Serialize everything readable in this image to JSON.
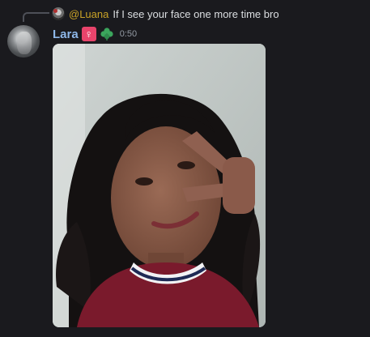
{
  "reply": {
    "mention": "@Luana",
    "text": "If I see your face one more time bro"
  },
  "message": {
    "author": "Lara",
    "badges": [
      "female-sign-icon",
      "clover-icon"
    ],
    "female_badge_glyph": "♀",
    "timestamp": "0:50",
    "attachment": "photo"
  },
  "colors": {
    "background": "#1a1a1e",
    "username": "#8eb7e8",
    "mention": "#c9a227",
    "timestamp": "#949ba4",
    "female_badge": "#e8446b",
    "clover_badge": "#3ba55c"
  }
}
